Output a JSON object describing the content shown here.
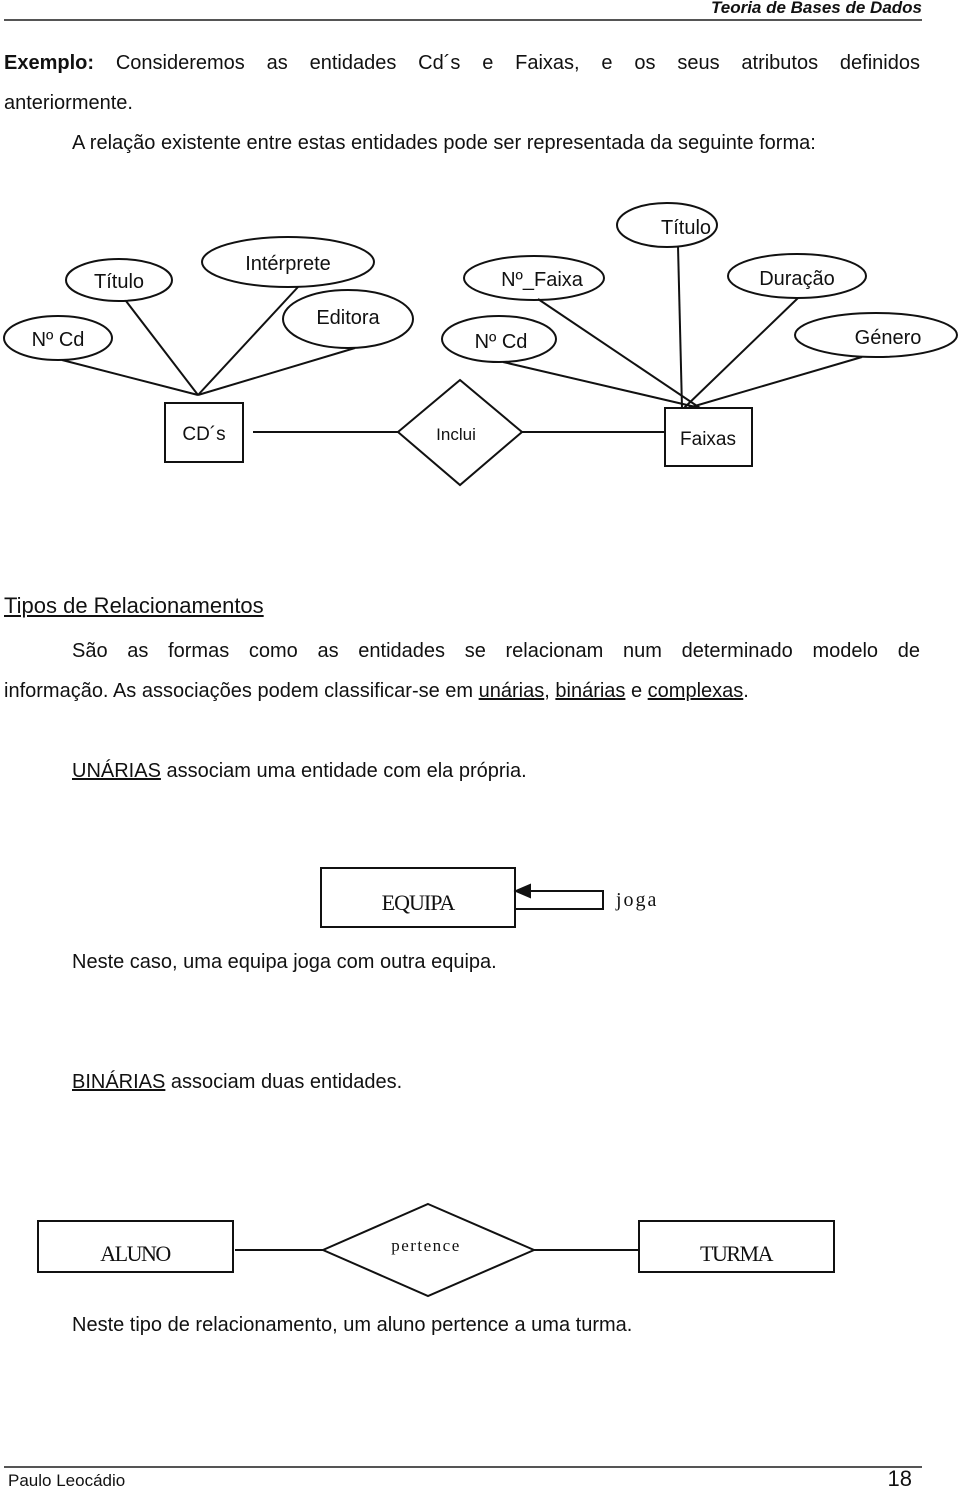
{
  "header": {
    "title": "Teoria de Bases de Dados"
  },
  "intro": {
    "label": "Exemplo:",
    "line1": "Consideremos as entidades Cd´s e Faixas, e os seus atributos definidos",
    "line2": "anteriormente.",
    "line3": "A relação existente entre estas entidades pode ser representada da seguinte forma:"
  },
  "er_diagram": {
    "entities": [
      {
        "id": "cds",
        "label": "CD´s"
      },
      {
        "id": "faixas",
        "label": "Faixas"
      }
    ],
    "relationship": {
      "label": "Inclui",
      "connects": [
        "cds",
        "faixas"
      ]
    },
    "attributes": {
      "cds": [
        "Nº Cd",
        "Título",
        "Intérprete",
        "Editora"
      ],
      "faixas": [
        "Nº_Faixa",
        "Nº Cd",
        "Título",
        "Duração",
        "Género"
      ]
    }
  },
  "section": {
    "heading": "Tipos de Relacionamentos",
    "para1_line1": "São as formas como as entidades se relacionam num determinado modelo de",
    "para1_line2_prefix": "informação. As associações podem classificar-se em ",
    "type_unarias": "unárias",
    "sep1": ", ",
    "type_binarias": "binárias",
    "sep2": " e ",
    "type_complexas": "complexas",
    "end": "."
  },
  "unary": {
    "term": "UNÁRIAS",
    "desc": " associam uma entidade com ela própria.",
    "entity": "EQUIPA",
    "relationship": "joga",
    "caption": "Neste caso, uma equipa joga com outra equipa."
  },
  "binary": {
    "term": "BINÁRIAS",
    "desc": " associam duas entidades.",
    "entity_left": "ALUNO",
    "relationship": "pertence",
    "entity_right": "TURMA",
    "caption": "Neste tipo de relacionamento, um aluno pertence a uma turma."
  },
  "footer": {
    "author": "Paulo Leocádio",
    "page": "18"
  }
}
